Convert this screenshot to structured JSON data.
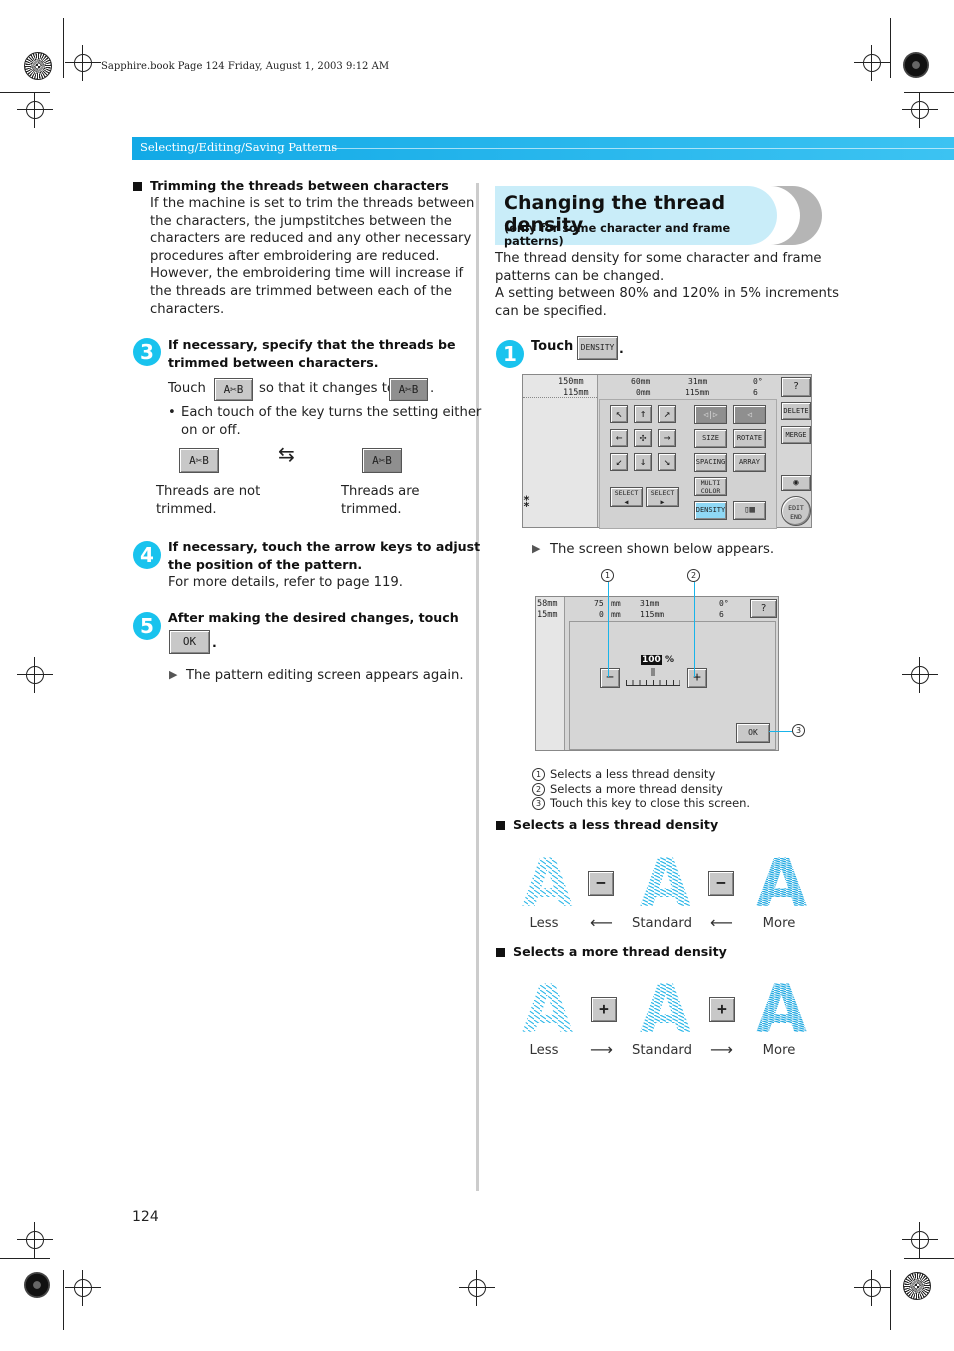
{
  "print_header": "Sapphire.book  Page 124  Friday, August 1, 2003  9:12 AM",
  "section_bar": {
    "title": "Selecting/Editing/Saving Patterns",
    "color": "#19b4ea"
  },
  "left": {
    "trimming_heading": "Trimming the threads between characters",
    "trimming_lines": [
      "If the machine is set to trim the threads between",
      "the characters, the jumpstitches between the",
      "characters are reduced and any other necessary",
      "procedures after embroidering are reduced.",
      "However, the embroidering time will increase if",
      "the threads are trimmed between each of the",
      "characters."
    ],
    "step3": {
      "num": "3",
      "lines": [
        "If necessary, specify that the threads be",
        "trimmed between characters."
      ],
      "touch": "Touch",
      "changes_to": "so that it changes to",
      "period": ".",
      "bullet_lines": [
        "Each touch of the key turns the setting either",
        "on or off."
      ],
      "key_label": "A✂B",
      "not_trimmed": [
        "Threads are not",
        "trimmed."
      ],
      "trimmed": [
        "Threads are",
        "trimmed."
      ]
    },
    "step4": {
      "num": "4",
      "lines": [
        "If necessary, touch the arrow keys to adjust",
        "the position of the pattern."
      ],
      "note": "For more details, refer to page 119."
    },
    "step5": {
      "num": "5",
      "line": "After making the desired changes, touch",
      "ok": "OK",
      "period": ".",
      "result": "The pattern editing screen appears again."
    }
  },
  "right": {
    "title": "Changing the thread density",
    "subtitle": "(only for some character and frame patterns)",
    "intro_lines": [
      "The thread density for some character and frame",
      "patterns can be changed.",
      "A setting between 80% and 120% in 5% increments",
      "can be specified."
    ],
    "step1": {
      "num": "1",
      "touch": "Touch",
      "key": "DENSITY",
      "period": "."
    },
    "screen1": {
      "left_h": "150mm",
      "left_w": "115mm",
      "info": [
        "60mm",
        "0mm",
        "31mm",
        "115mm",
        "0°",
        "6"
      ],
      "keys": {
        "size": "SIZE",
        "rotate": "ROTATE",
        "spacing": "SPACING",
        "array": "ARRAY",
        "multi_color": "MULTI COLOR",
        "density": "DENSITY",
        "select_left": "SELECT ◀",
        "select_right": "SELECT ▶",
        "delete": "DELETE",
        "merge": "MERGE",
        "edit_end": "EDIT END"
      }
    },
    "screen_appears": "The screen shown below appears.",
    "screen2": {
      "left_h": "58mm",
      "left_w": "15mm",
      "info": [
        "75",
        "mm",
        "0",
        "mm",
        "31mm",
        "115mm",
        "0°",
        "6"
      ],
      "value": "100",
      "unit": "%",
      "minus": "−",
      "plus": "+",
      "ok": "OK",
      "callouts": [
        "1",
        "2",
        "3"
      ]
    },
    "legend": [
      "Selects a less thread density",
      "Selects a more thread density",
      "Touch this key to close this screen."
    ],
    "less_heading": "Selects a less thread density",
    "more_heading": "Selects a more thread density",
    "labels": {
      "less": "Less",
      "standard": "Standard",
      "more": "More"
    },
    "arrows": {
      "left": "⟵",
      "right": "⟶"
    },
    "stitch_color": "#29b6e8"
  },
  "page_number": "124"
}
